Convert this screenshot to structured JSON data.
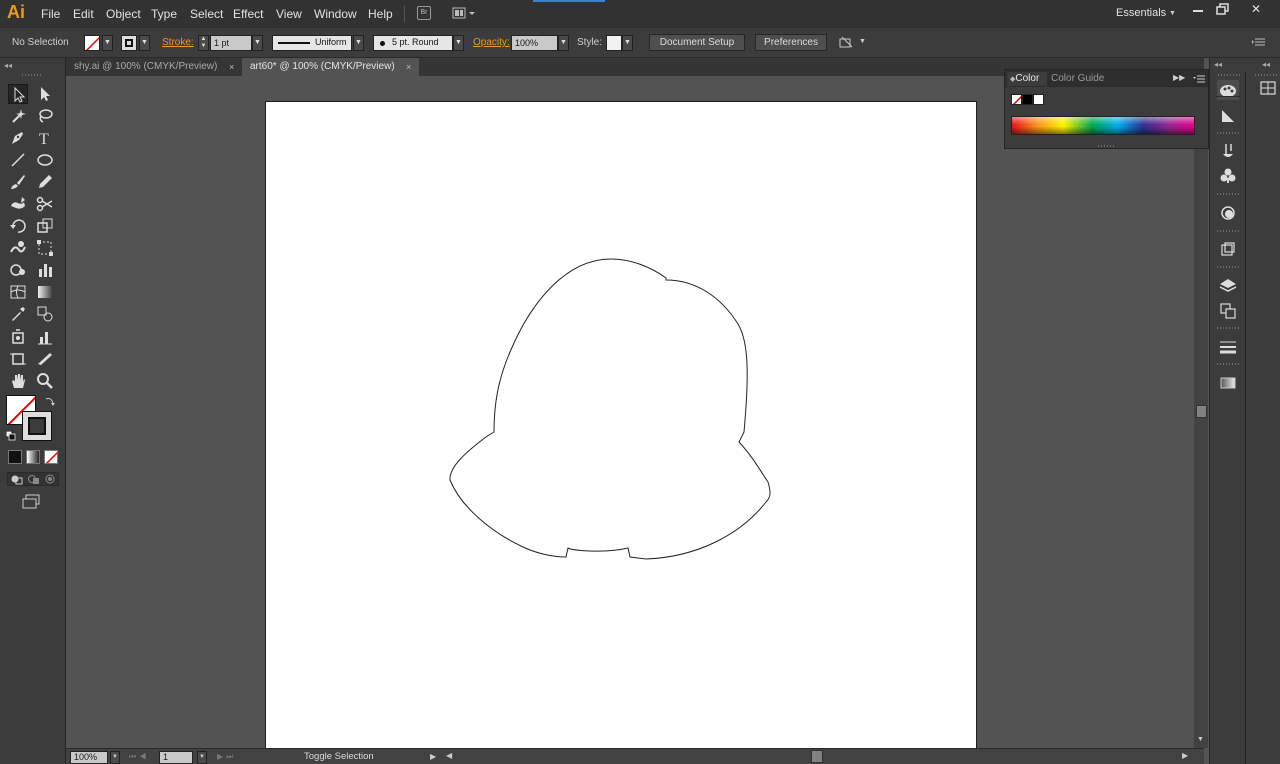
{
  "app": {
    "logo": "Ai",
    "workspace": "Essentials"
  },
  "menu": [
    "File",
    "Edit",
    "Object",
    "Type",
    "Select",
    "Effect",
    "View",
    "Window",
    "Help"
  ],
  "window_buttons": {
    "minimize": "▁",
    "restore": "❐",
    "close": "✕"
  },
  "control_bar": {
    "selection": "No Selection",
    "stroke_label": "Stroke:",
    "stroke_weight": "1 pt",
    "stroke_profile": "Uniform",
    "brush": "5 pt. Round",
    "opacity_label": "Opacity:",
    "opacity_value": "100%",
    "style_label": "Style:",
    "document_setup": "Document Setup",
    "preferences": "Preferences"
  },
  "tabs": [
    {
      "label": "shy.ai @ 100% (CMYK/Preview)",
      "close": "×",
      "active": false
    },
    {
      "label": "art60* @ 100% (CMYK/Preview)",
      "close": "×",
      "active": true
    }
  ],
  "status_bar": {
    "zoom": "100%",
    "page": "1",
    "toggle": "Toggle Selection"
  },
  "color_panel": {
    "tab_color": "Color",
    "tab_guide": "Color Guide"
  },
  "colors": {
    "accent": "#e89c1c",
    "ui_dark": "#323232",
    "ui_panel": "#3c3c3c",
    "pasteboard": "#535353",
    "artboard": "#ffffff"
  },
  "tools": [
    "selection-tool-icon",
    "direct-selection-tool-icon",
    "magic-wand-tool-icon",
    "lasso-tool-icon",
    "pen-tool-icon",
    "type-tool-icon",
    "line-tool-icon",
    "ellipse-tool-icon",
    "paintbrush-tool-icon",
    "pencil-tool-icon",
    "blob-brush-tool-icon",
    "scissors-tool-icon",
    "rotate-tool-icon",
    "scale-tool-icon",
    "warp-tool-icon",
    "free-transform-tool-icon",
    "symbol-sprayer-tool-icon",
    "column-graph-tool-icon",
    "mesh-tool-icon",
    "gradient-tool-icon",
    "eyedropper-tool-icon",
    "blend-tool-icon",
    "symbol-tool-icon",
    "graph-tool-icon",
    "artboard-tool-icon",
    "slice-tool-icon",
    "hand-tool-icon",
    "zoom-tool-icon"
  ]
}
